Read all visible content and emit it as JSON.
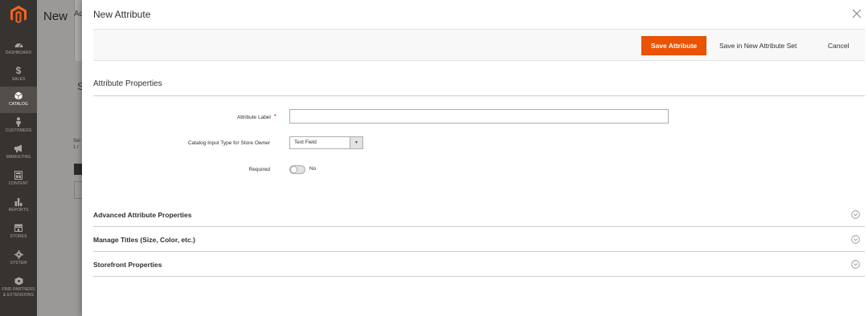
{
  "sidebar": {
    "items": [
      {
        "label": "DASHBOARD",
        "icon": "dashboard-icon"
      },
      {
        "label": "SALES",
        "icon": "dollar-icon"
      },
      {
        "label": "CATALOG",
        "icon": "cube-icon",
        "active": true
      },
      {
        "label": "CUSTOMERS",
        "icon": "person-icon"
      },
      {
        "label": "MARKETING",
        "icon": "megaphone-icon"
      },
      {
        "label": "CONTENT",
        "icon": "layout-icon"
      },
      {
        "label": "REPORTS",
        "icon": "bar-chart-icon"
      },
      {
        "label": "STORES",
        "icon": "store-icon"
      },
      {
        "label": "SYSTEM",
        "icon": "gear-icon"
      },
      {
        "label_line1": "FIND PARTNERS",
        "label_line2": "& EXTENSIONS",
        "icon": "box-icon"
      }
    ]
  },
  "background": {
    "page_title": "New",
    "tab_fragment": "Ad",
    "section_fragment": "S",
    "select_fragment_1": "Sel",
    "select_fragment_2": "1 r"
  },
  "modal": {
    "title": "New Attribute",
    "actions": {
      "save": "Save Attribute",
      "save_new_set": "Save in New Attribute Set",
      "cancel": "Cancel"
    },
    "section_title": "Attribute Properties",
    "fields": {
      "attribute_label": {
        "label": "Attribute Label",
        "required_mark": "*",
        "value": ""
      },
      "input_type": {
        "label": "Catalog Input Type for Store Owner",
        "value": "Text Field"
      },
      "required": {
        "label": "Required",
        "state_text": "No"
      }
    },
    "collapsibles": [
      {
        "title": "Advanced Attribute Properties"
      },
      {
        "title": "Manage Titles (Size, Color, etc.)"
      },
      {
        "title": "Storefront Properties"
      }
    ]
  },
  "colors": {
    "accent": "#eb5202",
    "sidebar_bg": "#373330",
    "sidebar_active": "#524d49"
  }
}
